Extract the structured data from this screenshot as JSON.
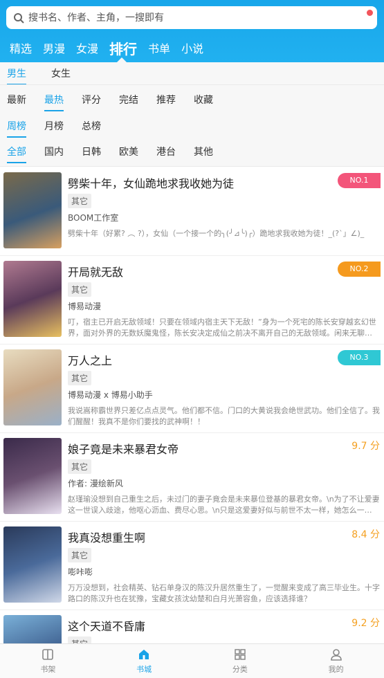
{
  "search": {
    "placeholder": "搜书名、作者、主角，一搜即有"
  },
  "topnav": {
    "items": [
      "精选",
      "男漫",
      "女漫",
      "排行",
      "书单",
      "小说"
    ],
    "active": "排行"
  },
  "filters": {
    "gender": [
      "男生",
      "女生"
    ],
    "sort": [
      "最新",
      "最热",
      "评分",
      "完结",
      "推荐",
      "收藏"
    ],
    "period": [
      "周榜",
      "月榜",
      "总榜"
    ],
    "region": [
      "全部",
      "国内",
      "日韩",
      "欧美",
      "港台",
      "其他"
    ],
    "selected": {
      "gender": "男生",
      "sort": "最热",
      "period": "周榜",
      "region": "全部"
    }
  },
  "colors": {
    "accent": "#1aa3e8",
    "rank1": "#f3557a",
    "rank2": "#f59a1e",
    "rank3": "#2fc8d4",
    "score": "#f4a021"
  },
  "list": [
    {
      "title": "劈柴十年，女仙跪地求我收她为徒",
      "tag": "其它",
      "author": "BOOM工作室",
      "desc": "劈柴十年（好累? ︵ ?），女仙（一个接一个的╮(╯⊿╰)╭）跪地求我收她为徒！_(?`」∠)_",
      "rank": "NO.1"
    },
    {
      "title": "开局就无敌",
      "tag": "其它",
      "author": "博易动漫",
      "desc": "叮，宿主已开启无敌领域！只要在领域内宿主天下无敌！”身为一个死宅的陈长安穿越玄幻世界，面对外界的无数妖魔鬼怪，陈长安决定成仙之前决不离开自己的无敌领域。闲来无聊…",
      "rank": "NO.2"
    },
    {
      "title": "万人之上",
      "tag": "其它",
      "author": "博易动漫 x 博易小助手",
      "desc": "我说嵩称霸世界只差亿点点灵气。他们都不信。门口的大黄说我会绝世武功。他们全信了。我们醒醒！我真不是你们要找的武神啊！！",
      "rank": "NO.3"
    },
    {
      "title": "娘子竟是未来暴君女帝",
      "tag": "其它",
      "author": "作者: 漫绘新风",
      "desc": "赵瑾瑜没想到自己重生之后，未过门的妻子竟会是未来暴位登基的暴君女帝。\\n为了不让爱妻这一世误入歧途，他呕心沥血、费尽心思。\\n只是这爱妻好似与前世不太一样，她怎么一…",
      "score": "9.7 分"
    },
    {
      "title": "我真没想重生啊",
      "tag": "其它",
      "author": "嘭咔嘭",
      "desc": "万万没想到，社会精英、钻石单身汉的陈汉升居然重生了，一觉醒来变成了高三毕业生。十字路口的陈汉升也在犹豫，宝藏女孩沈幼楚和白月光萧容鱼，应该选择谁？",
      "score": "8.4 分"
    },
    {
      "title": "这个天道不昏庸",
      "tag": "其它",
      "author": "",
      "desc": "",
      "score": "9.2 分"
    }
  ],
  "tabbar": {
    "items": [
      "书架",
      "书城",
      "分类",
      "我的"
    ],
    "active": "书城"
  }
}
